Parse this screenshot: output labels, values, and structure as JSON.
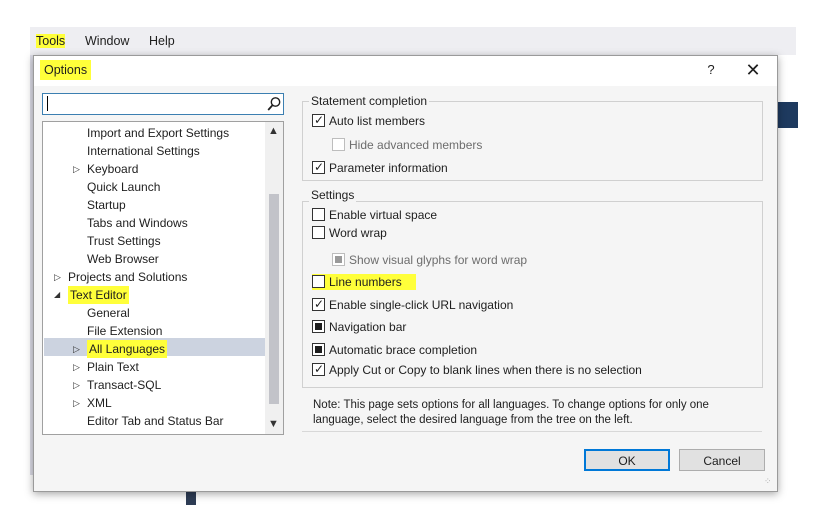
{
  "menubar": {
    "items": [
      "Tools",
      "Window",
      "Help"
    ]
  },
  "dialog": {
    "title": "Options",
    "help_label": "?",
    "close_label": "✕"
  },
  "search": {
    "placeholder": "",
    "value": ""
  },
  "tree": {
    "items": [
      {
        "label": "Import and Export Settings",
        "level": 2,
        "arrow": ""
      },
      {
        "label": "International Settings",
        "level": 2,
        "arrow": ""
      },
      {
        "label": "Keyboard",
        "level": 2,
        "arrow": "right"
      },
      {
        "label": "Quick Launch",
        "level": 2,
        "arrow": ""
      },
      {
        "label": "Startup",
        "level": 2,
        "arrow": ""
      },
      {
        "label": "Tabs and Windows",
        "level": 2,
        "arrow": ""
      },
      {
        "label": "Trust Settings",
        "level": 2,
        "arrow": ""
      },
      {
        "label": "Web Browser",
        "level": 2,
        "arrow": ""
      },
      {
        "label": "Projects and Solutions",
        "level": 1,
        "arrow": "right"
      },
      {
        "label": "Text Editor",
        "level": 1,
        "arrow": "down"
      },
      {
        "label": "General",
        "level": 2,
        "arrow": ""
      },
      {
        "label": "File Extension",
        "level": 2,
        "arrow": ""
      },
      {
        "label": "All Languages",
        "level": 2,
        "arrow": "right"
      },
      {
        "label": "Plain Text",
        "level": 2,
        "arrow": "right"
      },
      {
        "label": "Transact-SQL",
        "level": 2,
        "arrow": "right"
      },
      {
        "label": "XML",
        "level": 2,
        "arrow": "right"
      },
      {
        "label": "Editor Tab and Status Bar",
        "level": 2,
        "arrow": ""
      }
    ],
    "selected": "All Languages"
  },
  "statement_completion": {
    "label": "Statement completion",
    "options": [
      {
        "label": "Auto list members",
        "state": "checked",
        "disabled": false
      },
      {
        "label": "Hide advanced members",
        "state": "unchecked",
        "disabled": true
      },
      {
        "label": "Parameter information",
        "state": "checked",
        "disabled": false
      }
    ]
  },
  "settings": {
    "label": "Settings",
    "options": [
      {
        "label": "Enable virtual space",
        "state": "unchecked",
        "disabled": false
      },
      {
        "label": "Word wrap",
        "state": "unchecked",
        "disabled": false
      },
      {
        "label": "Show visual glyphs for word wrap",
        "state": "indeterminate",
        "disabled": true
      },
      {
        "label": "Line numbers",
        "state": "unchecked",
        "disabled": false
      },
      {
        "label": "Enable single-click URL navigation",
        "state": "checked",
        "disabled": false
      },
      {
        "label": "Navigation bar",
        "state": "indeterminate",
        "disabled": false
      },
      {
        "label": "Automatic brace completion",
        "state": "indeterminate",
        "disabled": false
      },
      {
        "label": "Apply Cut or Copy to blank lines when there is no selection",
        "state": "checked",
        "disabled": false
      }
    ]
  },
  "note": "Note: This page sets options for all languages. To change options for only one language, select the desired language from the tree on the left.",
  "buttons": {
    "ok": "OK",
    "cancel": "Cancel"
  },
  "colors": {
    "highlight": "#ffff3a",
    "selection": "#ccd3e0",
    "accent": "#0078d7"
  }
}
